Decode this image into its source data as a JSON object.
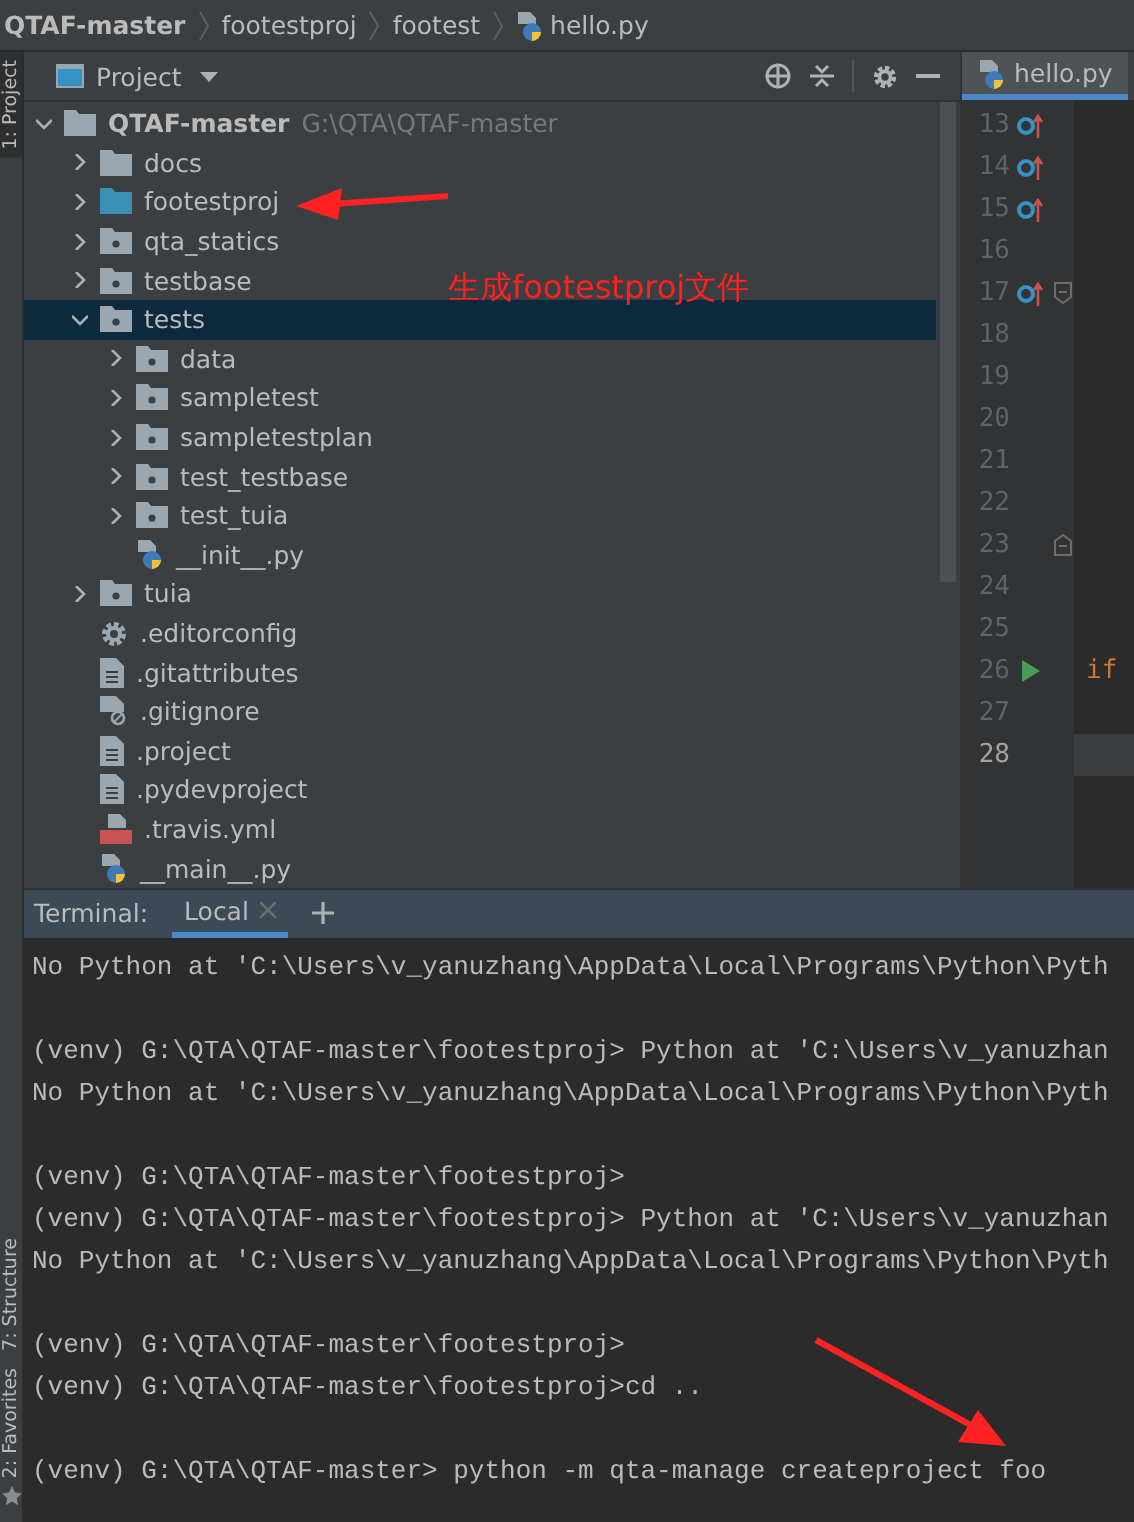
{
  "breadcrumb": [
    {
      "label": "QTAF-master",
      "kind": "root"
    },
    {
      "label": "footestproj",
      "kind": "folder"
    },
    {
      "label": "footest",
      "kind": "folder"
    },
    {
      "label": "hello.py",
      "kind": "python"
    }
  ],
  "side_strip": [
    {
      "label": "1: Project",
      "kind": "project",
      "selected": true
    },
    {
      "label": "7: Structure",
      "kind": "structure",
      "selected": false
    },
    {
      "label": "2: Favorites",
      "kind": "favorites",
      "selected": false
    }
  ],
  "project_panel": {
    "title": "Project",
    "tree": [
      {
        "label": "QTAF-master",
        "path": "G:\\QTA\\QTAF-master",
        "kind": "folder",
        "expanded": true,
        "selected": false,
        "children": [
          {
            "label": "docs",
            "kind": "folder",
            "expanded": false,
            "selected": false
          },
          {
            "label": "footestproj",
            "kind": "marked-folder",
            "expanded": false,
            "selected": false
          },
          {
            "label": "qta_statics",
            "kind": "package",
            "expanded": false,
            "selected": false
          },
          {
            "label": "testbase",
            "kind": "package",
            "expanded": false,
            "selected": false
          },
          {
            "label": "tests",
            "kind": "package",
            "expanded": true,
            "selected": true,
            "children": [
              {
                "label": "data",
                "kind": "package",
                "expanded": false,
                "selected": false
              },
              {
                "label": "sampletest",
                "kind": "package",
                "expanded": false,
                "selected": false
              },
              {
                "label": "sampletestplan",
                "kind": "package",
                "expanded": false,
                "selected": false
              },
              {
                "label": "test_testbase",
                "kind": "package",
                "expanded": false,
                "selected": false
              },
              {
                "label": "test_tuia",
                "kind": "package",
                "expanded": false,
                "selected": false
              },
              {
                "label": "__init__.py",
                "kind": "python",
                "selected": false
              }
            ]
          },
          {
            "label": "tuia",
            "kind": "package",
            "expanded": false,
            "selected": false
          },
          {
            "label": ".editorconfig",
            "kind": "config",
            "selected": false
          },
          {
            "label": ".gitattributes",
            "kind": "text",
            "selected": false
          },
          {
            "label": ".gitignore",
            "kind": "ignored",
            "selected": false
          },
          {
            "label": ".project",
            "kind": "text",
            "selected": false
          },
          {
            "label": ".pydevproject",
            "kind": "text",
            "selected": false
          },
          {
            "label": ".travis.yml",
            "kind": "yml",
            "selected": false
          },
          {
            "label": "__main__.py",
            "kind": "python",
            "selected": false
          }
        ]
      }
    ]
  },
  "editor": {
    "tab": {
      "label": "hello.py",
      "selected": true
    },
    "lines": [
      {
        "number": "13",
        "kind": "override",
        "current": false
      },
      {
        "number": "14",
        "kind": "override",
        "current": false
      },
      {
        "number": "15",
        "kind": "override",
        "current": false
      },
      {
        "number": "16",
        "kind": "plain",
        "current": false
      },
      {
        "number": "17",
        "kind": "overridefold",
        "current": false
      },
      {
        "number": "18",
        "kind": "plain",
        "current": false
      },
      {
        "number": "19",
        "kind": "plain",
        "current": false
      },
      {
        "number": "20",
        "kind": "plain",
        "current": false
      },
      {
        "number": "21",
        "kind": "plain",
        "current": false
      },
      {
        "number": "22",
        "kind": "plain",
        "current": false
      },
      {
        "number": "23",
        "kind": "foldend",
        "current": false
      },
      {
        "number": "24",
        "kind": "plain",
        "current": false
      },
      {
        "number": "25",
        "kind": "plain",
        "current": false
      },
      {
        "number": "26",
        "kind": "run",
        "current": false,
        "code": "if"
      },
      {
        "number": "27",
        "kind": "plain",
        "current": false
      },
      {
        "number": "28",
        "kind": "plain",
        "current": true
      }
    ]
  },
  "terminal": {
    "label": "Terminal:",
    "tabs": [
      {
        "label": "Local",
        "selected": true
      }
    ],
    "blocks": [
      {
        "lines": [
          "No Python at 'C:\\Users\\v_yanuzhang\\AppData\\Local\\Programs\\Python\\Pyth"
        ]
      },
      {
        "lines": [
          "(venv) G:\\QTA\\QTAF-master\\footestproj> Python at 'C:\\Users\\v_yanuzhan",
          "No Python at 'C:\\Users\\v_yanuzhang\\AppData\\Local\\Programs\\Python\\Pyth"
        ]
      },
      {
        "lines": [
          "(venv) G:\\QTA\\QTAF-master\\footestproj>",
          "(venv) G:\\QTA\\QTAF-master\\footestproj> Python at 'C:\\Users\\v_yanuzhan",
          "No Python at 'C:\\Users\\v_yanuzhang\\AppData\\Local\\Programs\\Python\\Pyth"
        ]
      },
      {
        "lines": [
          "(venv) G:\\QTA\\QTAF-master\\footestproj>",
          "(venv) G:\\QTA\\QTAF-master\\footestproj>cd .."
        ]
      },
      {
        "lines": [
          "(venv) G:\\QTA\\QTAF-master> python -m qta-manage createproject foo"
        ]
      }
    ]
  },
  "annotations": [
    {
      "text": "生成footestproj文件"
    }
  ]
}
